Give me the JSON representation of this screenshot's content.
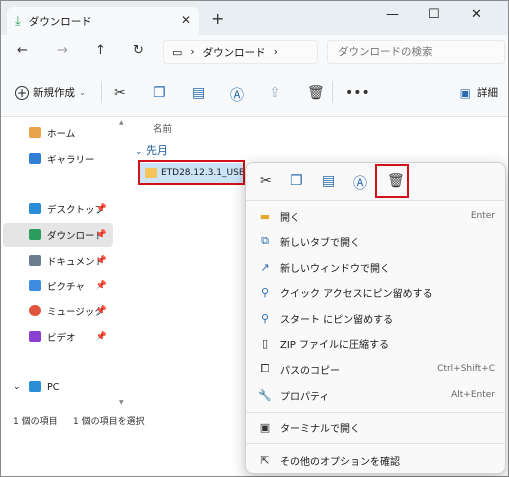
{
  "tab": {
    "title": "ダウンロード"
  },
  "address": {
    "path": "ダウンロード",
    "search_placeholder": "ダウンロードの検索"
  },
  "toolbar": {
    "new_label": "新規作成",
    "detail_label": "詳細"
  },
  "sidebar": {
    "items": [
      {
        "label": "ホーム",
        "icon": "home-icon"
      },
      {
        "label": "ギャラリー",
        "icon": "gallery-icon"
      },
      {
        "label": "デスクトップ",
        "icon": "desktop-icon"
      },
      {
        "label": "ダウンロード",
        "icon": "download-icon"
      },
      {
        "label": "ドキュメント",
        "icon": "documents-icon"
      },
      {
        "label": "ピクチャ",
        "icon": "pictures-icon"
      },
      {
        "label": "ミュージック",
        "icon": "music-icon"
      },
      {
        "label": "ビデオ",
        "icon": "videos-icon"
      },
      {
        "label": "PC",
        "icon": "pc-icon"
      }
    ]
  },
  "main": {
    "column_name": "名前",
    "group_label": "先月",
    "file_name": "ETD28.12.3.1_USB"
  },
  "status": {
    "count": "1 個の項目",
    "selected": "1 個の項目を選択"
  },
  "context_menu": {
    "items": [
      {
        "label": "開く",
        "shortcut": "Enter"
      },
      {
        "label": "新しいタブで開く",
        "shortcut": ""
      },
      {
        "label": "新しいウィンドウで開く",
        "shortcut": ""
      },
      {
        "label": "クイック アクセスにピン留めする",
        "shortcut": ""
      },
      {
        "label": "スタート にピン留めする",
        "shortcut": ""
      },
      {
        "label": "ZIP ファイルに圧縮する",
        "shortcut": ""
      },
      {
        "label": "パスのコピー",
        "shortcut": "Ctrl+Shift+C"
      },
      {
        "label": "プロパティ",
        "shortcut": "Alt+Enter"
      },
      {
        "label": "ターミナルで開く",
        "shortcut": ""
      },
      {
        "label": "その他のオプションを確認",
        "shortcut": ""
      }
    ]
  },
  "colors": {
    "accent": "#2b6cb0",
    "highlight": "#d0101a",
    "selection": "#cce4f7"
  }
}
